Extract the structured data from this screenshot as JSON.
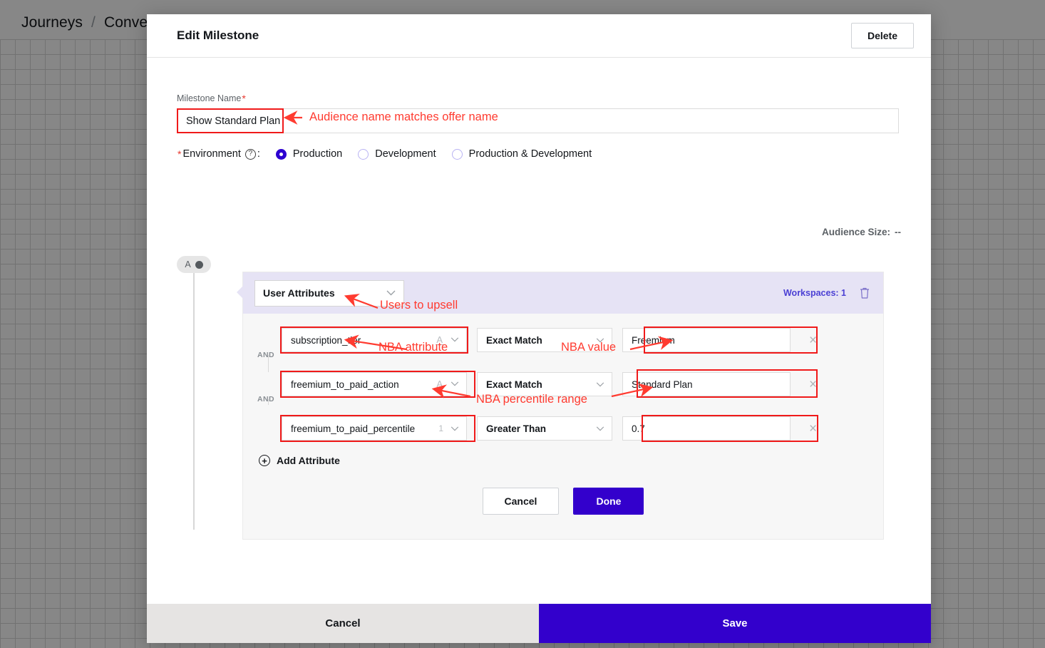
{
  "background": {
    "breadcrumb": [
      "Journeys",
      "Conve"
    ],
    "separator": "/"
  },
  "modal": {
    "title": "Edit Milestone",
    "delete_label": "Delete",
    "name_field": {
      "label": "Milestone Name",
      "required_mark": "*",
      "value": "Show Standard Plan"
    },
    "environment": {
      "required_mark": "*",
      "label": "Environment",
      "help_icon": "?",
      "colon": ":",
      "options": [
        {
          "label": "Production",
          "selected": true
        },
        {
          "label": "Development",
          "selected": false
        },
        {
          "label": "Production & Development",
          "selected": false
        }
      ]
    },
    "audience_size": {
      "label": "Audience Size:",
      "value": "--"
    },
    "builder": {
      "badge_letter": "A",
      "type_select": {
        "value": "User Attributes",
        "chevron": "chevron-down"
      },
      "workspaces_label": "Workspaces: 1",
      "trash_icon": "trash",
      "and_label": "AND",
      "conditions": [
        {
          "attribute": "subscription_tier",
          "attr_type_icon": "A",
          "operator": "Exact Match",
          "value": "Freemium",
          "remove_icon": "×"
        },
        {
          "attribute": "freemium_to_paid_action",
          "attr_type_icon": "A",
          "operator": "Exact Match",
          "value": "Standard Plan",
          "remove_icon": "×"
        },
        {
          "attribute": "freemium_to_paid_percentile",
          "attr_type_icon": "1",
          "operator": "Greater Than",
          "value": "0.7",
          "remove_icon": "×"
        }
      ],
      "add_attribute_label": "Add Attribute",
      "add_icon": "plus-circle",
      "cancel_label": "Cancel",
      "done_label": "Done"
    },
    "footer": {
      "cancel_label": "Cancel",
      "save_label": "Save"
    }
  },
  "annotations": [
    {
      "id": "a1",
      "text": "Audience name matches offer name"
    },
    {
      "id": "a2",
      "text": "Users to upsell"
    },
    {
      "id": "a3",
      "text": "NBA attribute"
    },
    {
      "id": "a4",
      "text": "NBA value"
    },
    {
      "id": "a5",
      "text": "NBA percentile range"
    }
  ],
  "colors": {
    "annotation": "#ff3b30",
    "highlight_box": "#f01a1a",
    "primary": "#3300cc",
    "radio_selected": "#2d00d1",
    "card_header": "#e6e3f5"
  }
}
